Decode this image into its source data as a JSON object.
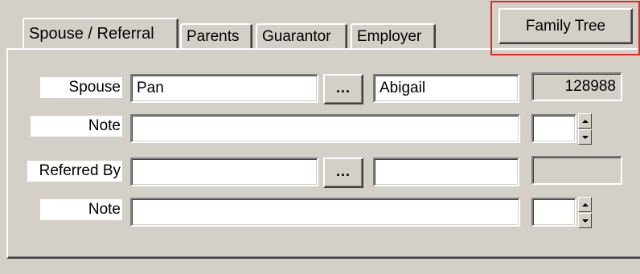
{
  "tabs": [
    {
      "label": "Spouse / Referral",
      "active": true
    },
    {
      "label": "Parents",
      "active": false
    },
    {
      "label": "Guarantor",
      "active": false
    },
    {
      "label": "Employer",
      "active": false
    }
  ],
  "family_tree_button": {
    "label": "Family Tree"
  },
  "spouse_row": {
    "label": "Spouse",
    "last_name": "Pan",
    "browse_label": "...",
    "first_name": "Abigail",
    "id": "128988"
  },
  "spouse_note_row": {
    "label": "Note",
    "value": "",
    "spinner_value": ""
  },
  "referred_row": {
    "label": "Referred By",
    "last_name": "",
    "browse_label": "...",
    "first_name": "",
    "id": ""
  },
  "referred_note_row": {
    "label": "Note",
    "value": "",
    "spinner_value": ""
  }
}
